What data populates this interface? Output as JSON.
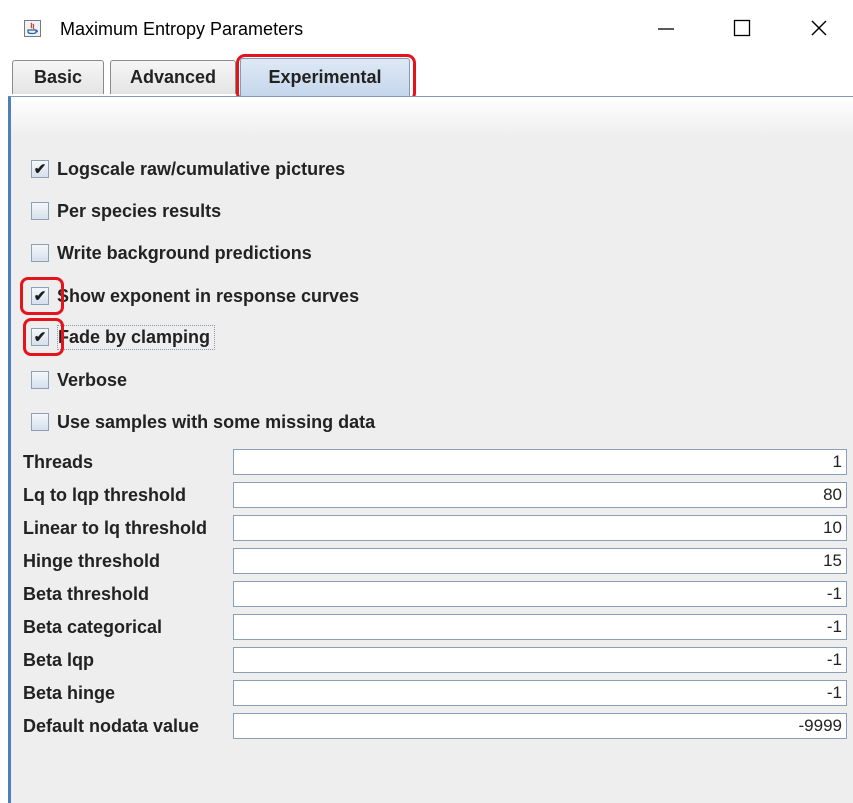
{
  "window": {
    "title": "Maximum Entropy Parameters",
    "controls": {
      "minimize": "—",
      "maximize": "☐",
      "close": "✕"
    }
  },
  "tabs": [
    {
      "label": "Basic",
      "selected": false
    },
    {
      "label": "Advanced",
      "selected": false
    },
    {
      "label": "Experimental",
      "selected": true
    }
  ],
  "checkboxes": [
    {
      "label": "Logscale raw/cumulative pictures",
      "checked": true,
      "highlighted": false
    },
    {
      "label": "Per species results",
      "checked": false,
      "highlighted": false
    },
    {
      "label": "Write background predictions",
      "checked": false,
      "highlighted": false
    },
    {
      "label": "Show exponent in response curves",
      "checked": true,
      "highlighted": true
    },
    {
      "label": "Fade by clamping",
      "checked": true,
      "highlighted": true,
      "focused": true
    },
    {
      "label": "Verbose",
      "checked": false,
      "highlighted": false
    },
    {
      "label": "Use samples with some missing data",
      "checked": false,
      "highlighted": false
    }
  ],
  "fields": [
    {
      "label": "Threads",
      "value": "1"
    },
    {
      "label": "Lq to lqp threshold",
      "value": "80"
    },
    {
      "label": "Linear to lq threshold",
      "value": "10"
    },
    {
      "label": "Hinge threshold",
      "value": "15"
    },
    {
      "label": "Beta threshold",
      "value": "-1"
    },
    {
      "label": "Beta categorical",
      "value": "-1"
    },
    {
      "label": "Beta lqp",
      "value": "-1"
    },
    {
      "label": "Beta hinge",
      "value": "-1"
    },
    {
      "label": "Default nodata value",
      "value": "-9999"
    }
  ],
  "colors": {
    "highlight": "#e3141b",
    "selected_tab": "#c5d6ec",
    "panel": "#eeeeee"
  }
}
